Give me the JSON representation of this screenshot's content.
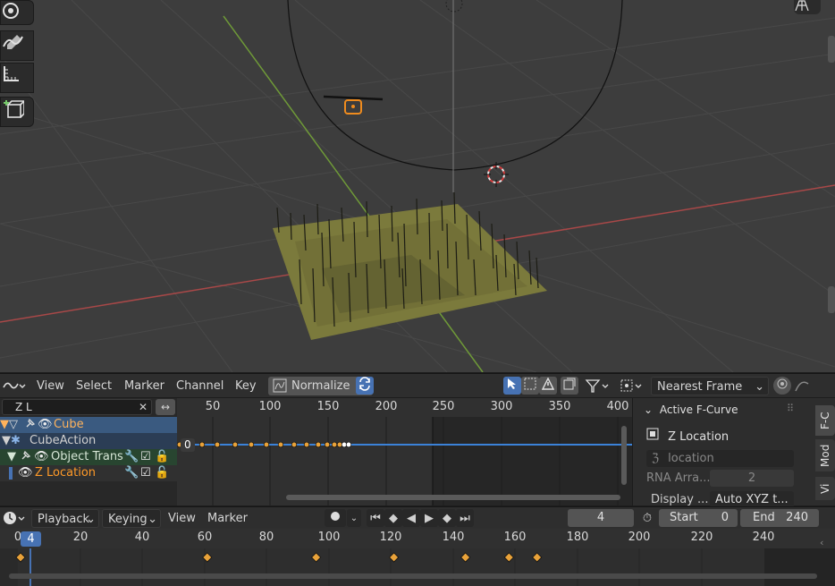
{
  "colors": {
    "accent": "#4772b3",
    "keyframe": "#e8a23a",
    "selection_orange": "#ffb35c",
    "fcurve_orange": "#ff9a28",
    "x_axis": "#c04a4a",
    "y_axis": "#7aa03a"
  },
  "viewport": {
    "tools": [
      "move-icon",
      "annotate-icon",
      "measure-icon",
      "add-cube-icon"
    ]
  },
  "dopesheet": {
    "menus": {
      "view": "View",
      "select": "Select",
      "marker": "Marker",
      "channel": "Channel",
      "key": "Key"
    },
    "normalize_label": "Normalize",
    "snapping": "Nearest Frame",
    "ruler_ticks": [
      "50",
      "100",
      "150",
      "200",
      "250",
      "300",
      "350",
      "400"
    ],
    "current_frame_label": "0"
  },
  "channels": {
    "search_value": "Z L",
    "rows": [
      "Cube",
      "CubeAction",
      "Object Trans",
      "Z Location"
    ]
  },
  "sidebar": {
    "panel_title": "Active F-Curve",
    "fcurve_name": "Z Location",
    "data_path": "location",
    "rna_array_label": "RNA Arra...",
    "rna_array_value": "2",
    "display_label": "Display ...",
    "display_value": "Auto XYZ t...",
    "tabs": [
      "F-C",
      "Mod",
      "Vi"
    ]
  },
  "timeline": {
    "menus": {
      "playback": "Playback",
      "keying": "Keying",
      "view": "View",
      "marker": "Marker"
    },
    "current_frame": "4",
    "start_label": "Start",
    "start_value": "0",
    "end_label": "End",
    "end_value": "240",
    "ruler_ticks": [
      "0",
      "20",
      "40",
      "60",
      "80",
      "100",
      "120",
      "140",
      "160",
      "180",
      "200",
      "220",
      "240"
    ],
    "keyframe_frames": [
      0,
      60,
      95,
      120,
      143,
      157,
      166
    ]
  }
}
